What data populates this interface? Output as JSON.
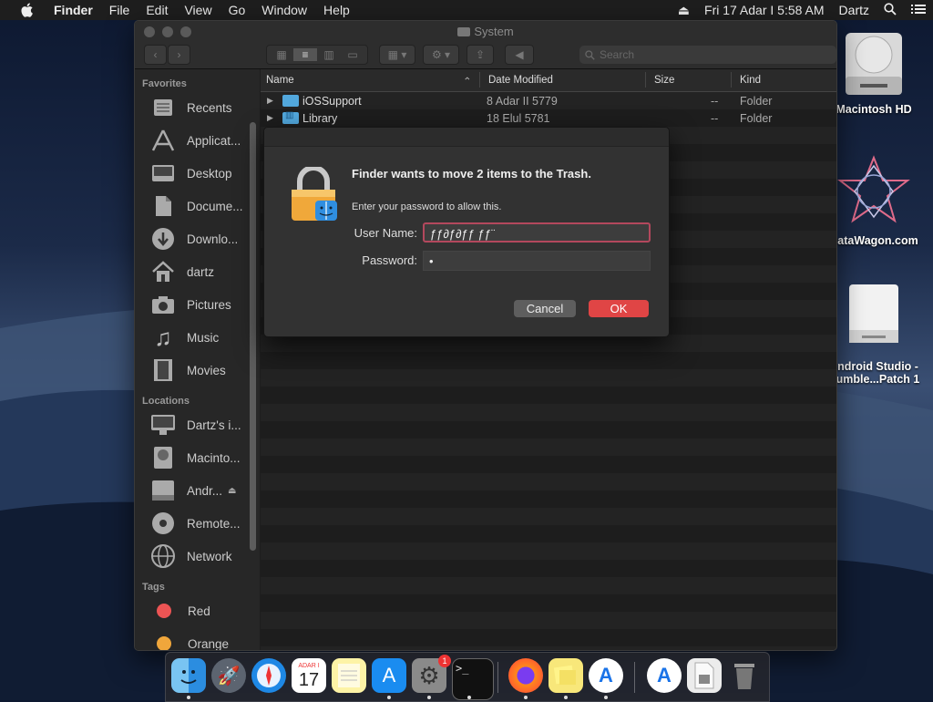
{
  "menubar": {
    "app": "Finder",
    "items": [
      "File",
      "Edit",
      "View",
      "Go",
      "Window",
      "Help"
    ],
    "datetime": "Fri 17 Adar I  5:58 AM",
    "user": "Dartz"
  },
  "desktop": {
    "icons": [
      {
        "label": "Macintosh HD"
      },
      {
        "label": "DataWagon.com"
      },
      {
        "label": "Android Studio - Bumble...Patch 1"
      }
    ]
  },
  "window": {
    "title": "System",
    "search_placeholder": "Search"
  },
  "sidebar": {
    "favorites_header": "Favorites",
    "favorites": [
      "Recents",
      "Applicat...",
      "Desktop",
      "Docume...",
      "Downlo...",
      "dartz",
      "Pictures",
      "Music",
      "Movies"
    ],
    "locations_header": "Locations",
    "locations": [
      "Dartz's i...",
      "Macinto...",
      "Andr...",
      "Remote...",
      "Network"
    ],
    "tags_header": "Tags",
    "tags": [
      {
        "label": "Red",
        "color": "#ec5454"
      },
      {
        "label": "Orange",
        "color": "#f0a63b"
      }
    ]
  },
  "columns": {
    "name": "Name",
    "date": "Date Modified",
    "size": "Size",
    "kind": "Kind"
  },
  "rows": [
    {
      "name": "iOSSupport",
      "date": "8 Adar II 5779",
      "size": "--",
      "kind": "Folder"
    },
    {
      "name": "Library",
      "date": "18 Elul 5781",
      "size": "--",
      "kind": "Folder"
    }
  ],
  "dialog": {
    "title": "Finder wants to move 2 items to the Trash.",
    "subtitle": "Enter your password to allow this.",
    "username_label": "User Name:",
    "username_value": "ƒƒ∂ƒ∂ƒƒ ƒƒ¨",
    "password_label": "Password:",
    "password_value": "•",
    "cancel": "Cancel",
    "ok": "OK"
  },
  "dock": {
    "calendar_month": "ADAR I",
    "calendar_day": "17",
    "settings_badge": "1"
  }
}
